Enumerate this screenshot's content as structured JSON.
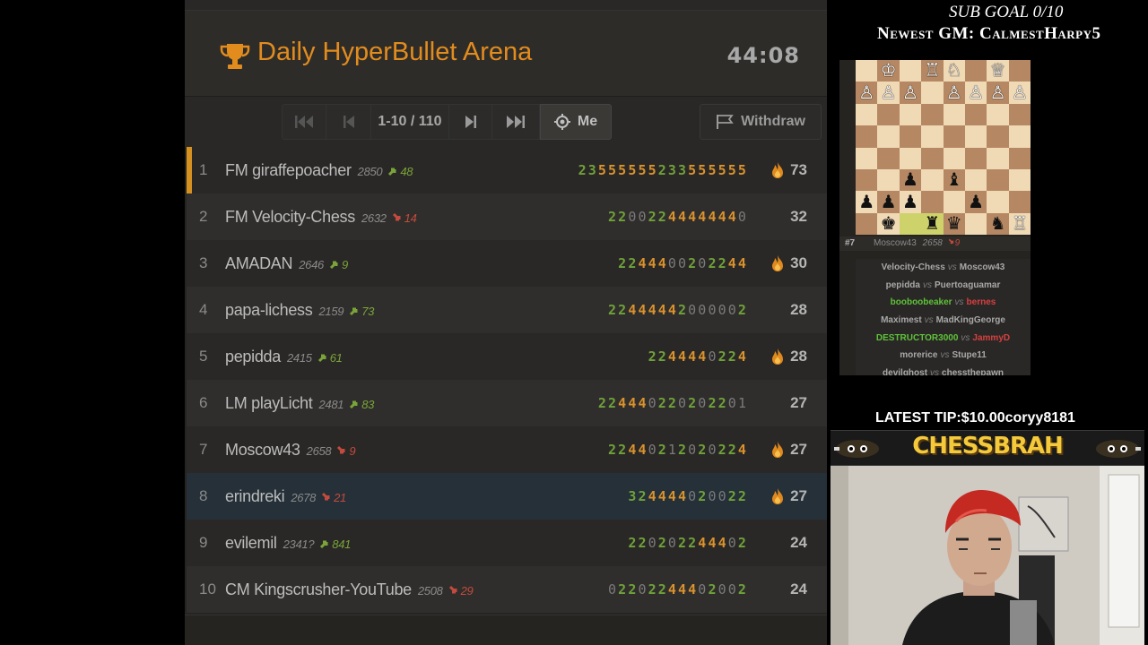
{
  "arena": {
    "title": "Daily HyperBullet Arena",
    "clock": "44:08",
    "pager": {
      "range": "1-10 / 110",
      "me_label": "Me",
      "withdraw_label": "Withdraw"
    },
    "standings": [
      {
        "rank": "1",
        "name": "FM giraffepoacher",
        "rating": "2850",
        "progress": "48",
        "trend": "up",
        "scores": "23555555233555555",
        "fire": true,
        "total": "73"
      },
      {
        "rank": "2",
        "name": "FM Velocity-Chess",
        "rating": "2632",
        "progress": "14",
        "trend": "down",
        "scores": "22002244444440",
        "fire": false,
        "total": "32"
      },
      {
        "rank": "3",
        "name": "AMADAN",
        "rating": "2646",
        "progress": "9",
        "trend": "up",
        "scores": "22444002022 44",
        "fire": true,
        "total": "30"
      },
      {
        "rank": "4",
        "name": "papa-lichess",
        "rating": "2159",
        "progress": "73",
        "trend": "up",
        "scores": "22444442000002",
        "fire": false,
        "total": "28"
      },
      {
        "rank": "5",
        "name": "pepidda",
        "rating": "2415",
        "progress": "61",
        "trend": "up",
        "scores": "224444 0224",
        "fire": true,
        "total": "28"
      },
      {
        "rank": "6",
        "name": "LM playLicht",
        "rating": "2481",
        "progress": "83",
        "trend": "up",
        "scores": "22444022020220 1",
        "fire": false,
        "total": "27"
      },
      {
        "rank": "7",
        "name": "Moscow43",
        "rating": "2658",
        "progress": "9",
        "trend": "down",
        "scores": "22440212020224",
        "fire": true,
        "total": "27"
      },
      {
        "rank": "8",
        "name": "erindreki",
        "rating": "2678",
        "progress": "21",
        "trend": "down",
        "scores": "324444020022",
        "fire": true,
        "total": "27"
      },
      {
        "rank": "9",
        "name": "evilemil",
        "rating": "2341?",
        "progress": "841",
        "trend": "up",
        "scores": "220202244402",
        "fire": false,
        "total": "24"
      },
      {
        "rank": "10",
        "name": "CM Kingscrusher-YouTube",
        "rating": "2508",
        "progress": "29",
        "trend": "down",
        "scores": "0220224440 2002",
        "fire": false,
        "total": "24"
      }
    ]
  },
  "overlay": {
    "sub_goal": "SUB GOAL 0/10",
    "newest_gm": "Newest GM: CalmestHarpy5",
    "latest_tip": "LATEST TIP:$10.00coryy8181",
    "banner": "CHESSBRAH"
  },
  "board": {
    "rank": "#7",
    "player": "Moscow43",
    "rating": "2658",
    "progress": "9",
    "games": [
      {
        "white": "Velocity-Chess",
        "black": "Moscow43",
        "result": ""
      },
      {
        "white": "pepidda",
        "black": "Puertoaguamar",
        "result": ""
      },
      {
        "white": "booboobeaker",
        "black": "bernes",
        "result": "white"
      },
      {
        "white": "Maximest",
        "black": "MadKingGeorge",
        "result": ""
      },
      {
        "white": "DESTRUCTOR3000",
        "black": "JammyD",
        "result": "white"
      },
      {
        "white": "morerice",
        "black": "Stupe11",
        "result": ""
      },
      {
        "white": "devilghost",
        "black": "chessthepawn",
        "result": ""
      }
    ],
    "vs": "vs"
  },
  "colors": {
    "accent": "#e28c1e",
    "win": "#6fa13a",
    "streak": "#d9922e",
    "loss": "#c44a3d"
  }
}
